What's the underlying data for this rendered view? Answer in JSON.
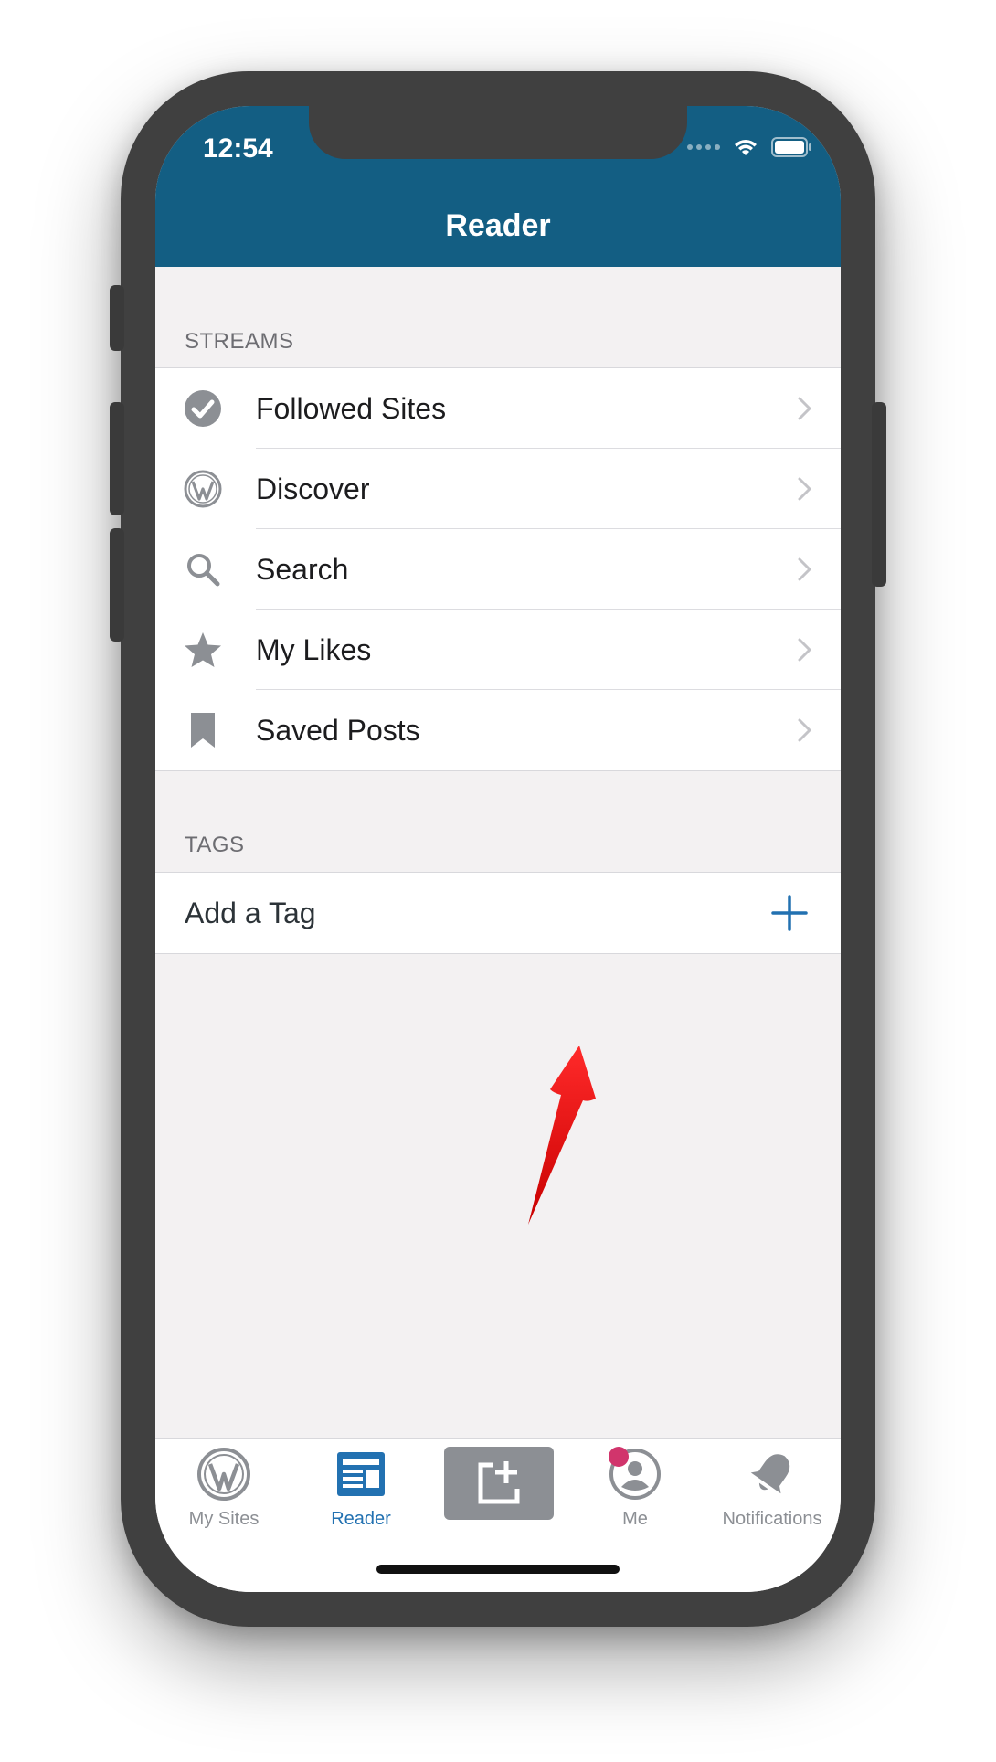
{
  "status_bar": {
    "time": "12:54"
  },
  "header": {
    "title": "Reader"
  },
  "streams": {
    "section_title": "STREAMS",
    "items": [
      {
        "label": "Followed Sites",
        "icon": "checkmark-circle-icon"
      },
      {
        "label": "Discover",
        "icon": "wordpress-icon"
      },
      {
        "label": "Search",
        "icon": "search-icon"
      },
      {
        "label": "My Likes",
        "icon": "star-icon"
      },
      {
        "label": "Saved Posts",
        "icon": "bookmark-icon"
      }
    ]
  },
  "tags": {
    "section_title": "TAGS",
    "add_label": "Add a Tag"
  },
  "tab_bar": {
    "items": [
      {
        "label": "My Sites",
        "icon": "wordpress-icon"
      },
      {
        "label": "Reader",
        "icon": "reader-icon",
        "active": true
      },
      {
        "label": "",
        "icon": "write-post-icon"
      },
      {
        "label": "Me",
        "icon": "profile-icon"
      },
      {
        "label": "Notifications",
        "icon": "bell-icon"
      }
    ]
  },
  "colors": {
    "header_bg": "#135e83",
    "accent": "#2271b1",
    "badge": "#d1356c",
    "annotation_arrow": "#e00000"
  }
}
